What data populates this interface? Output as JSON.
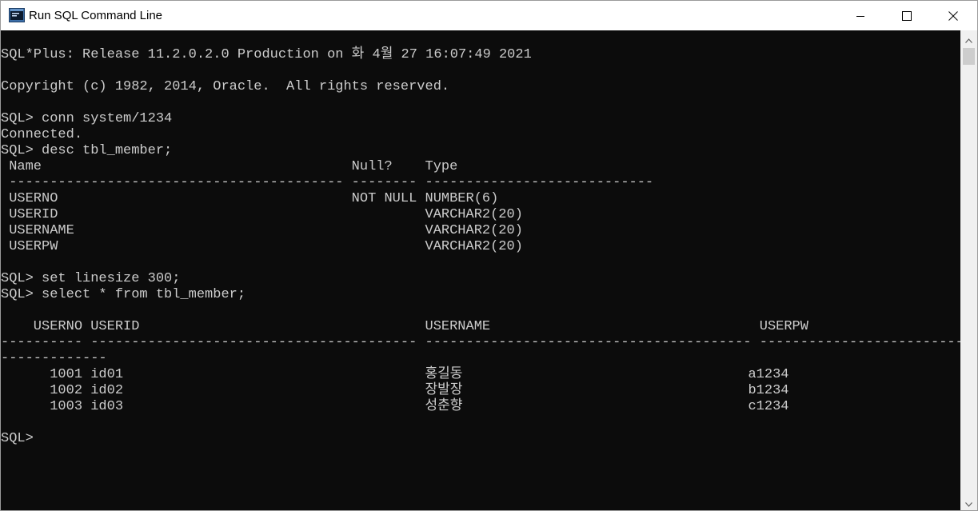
{
  "window": {
    "title": "Run SQL Command Line",
    "icon_name": "sql-console-icon",
    "controls": {
      "minimize": "minimize-icon",
      "maximize": "maximize-icon",
      "close": "close-icon"
    }
  },
  "colors": {
    "console_bg": "#0c0c0c",
    "console_text": "#cccccc",
    "titlebar_bg": "#ffffff",
    "scrollbar_bg": "#f0f0f0"
  },
  "console": {
    "lines": [
      "SQL*Plus: Release 11.2.0.2.0 Production on 화 4월 27 16:07:49 2021",
      "",
      "Copyright (c) 1982, 2014, Oracle.  All rights reserved.",
      "",
      "SQL> conn system/1234",
      "Connected.",
      "SQL> desc tbl_member;",
      " Name                                      Null?    Type",
      " ----------------------------------------- -------- ----------------------------",
      " USERNO                                    NOT NULL NUMBER(6)",
      " USERID                                             VARCHAR2(20)",
      " USERNAME                                           VARCHAR2(20)",
      " USERPW                                             VARCHAR2(20)",
      "",
      "SQL> set linesize 300;",
      "SQL> select * from tbl_member;",
      "",
      "    USERNO USERID                                   USERNAME                                 USERPW",
      "---------- ---------------------------------------- ---------------------------------------- --------------------------------------------------------------------------------------------------------------------------",
      "-------------",
      "      1001 id01                                     홍길동                                   a1234",
      "      1002 id02                                     장발장                                   b1234",
      "      1003 id03                                     성춘향                                   c1234",
      "",
      "SQL>"
    ]
  }
}
